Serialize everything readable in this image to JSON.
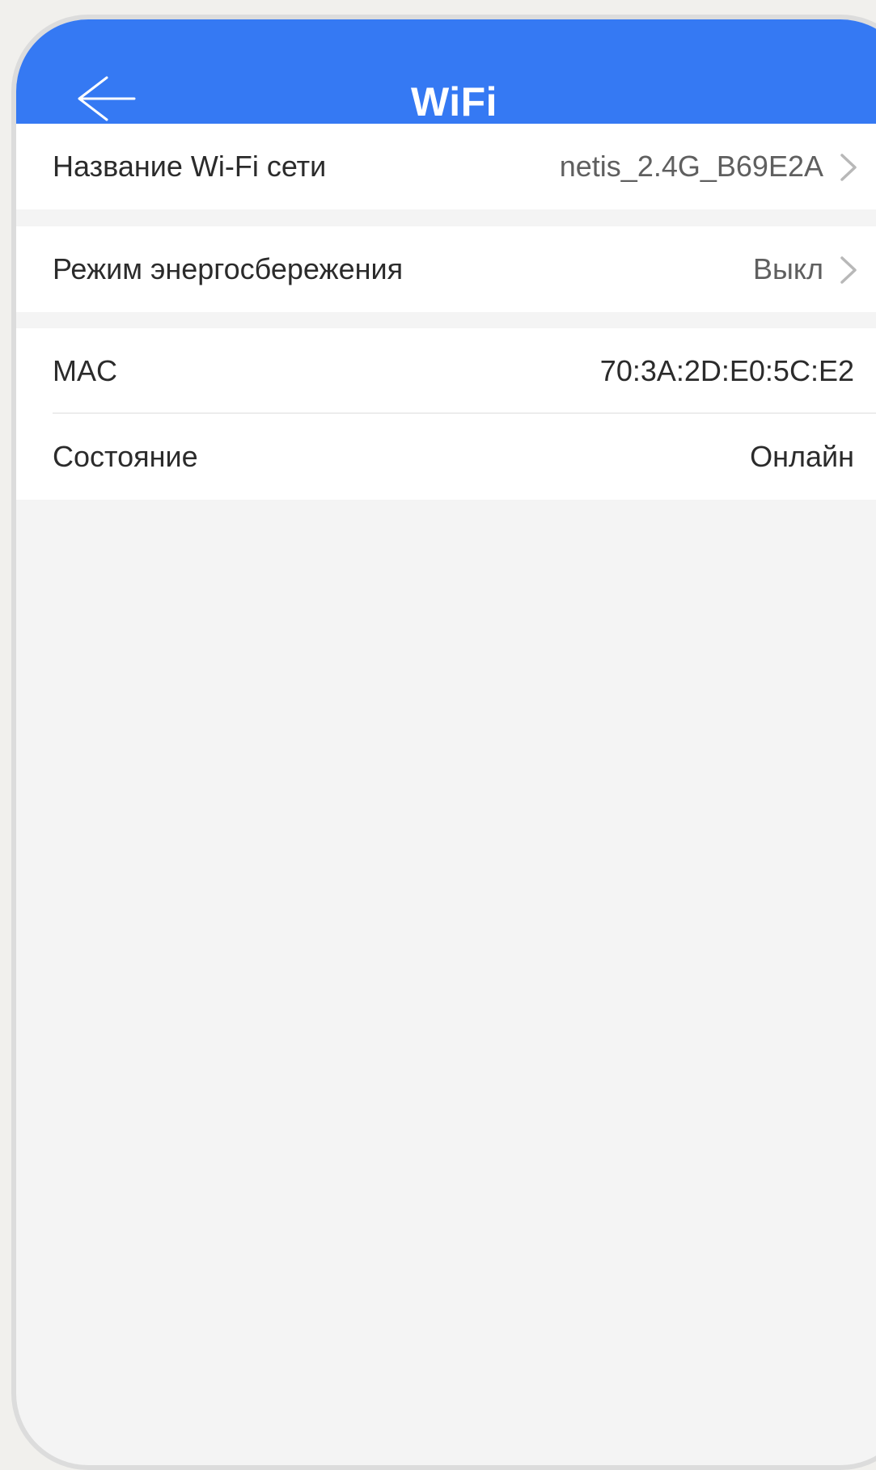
{
  "header": {
    "title": "WiFi",
    "back_icon": "arrow-left-icon"
  },
  "wifi_name": {
    "label": "Название Wi-Fi сети",
    "value": "netis_2.4G_B69E2A"
  },
  "power_saving": {
    "label": "Режим энергосбережения",
    "value": "Выкл"
  },
  "mac": {
    "label": "MAC",
    "value": "70:3A:2D:E0:5C:E2"
  },
  "status": {
    "label": "Состояние",
    "value": "Онлайн"
  },
  "colors": {
    "header_bg": "#3579f3",
    "page_bg": "#f4f4f4",
    "row_bg": "#ffffff",
    "chevron": "#b8b8b8"
  }
}
